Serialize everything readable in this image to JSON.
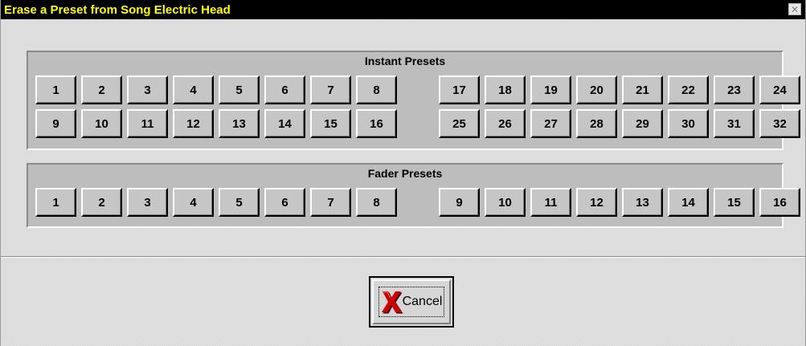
{
  "window": {
    "title": "Erase a Preset from Song Electric Head",
    "close_icon": "close-icon"
  },
  "colors": {
    "titlebar_bg": "#000000",
    "titlebar_text": "#ffff00",
    "x_icon": "#cc0000"
  },
  "instant_presets": {
    "title": "Instant Presets",
    "row1_left": [
      "1",
      "2",
      "3",
      "4",
      "5",
      "6",
      "7",
      "8"
    ],
    "row1_right": [
      "17",
      "18",
      "19",
      "20",
      "21",
      "22",
      "23",
      "24"
    ],
    "row2_left": [
      "9",
      "10",
      "11",
      "12",
      "13",
      "14",
      "15",
      "16"
    ],
    "row2_right": [
      "25",
      "26",
      "27",
      "28",
      "29",
      "30",
      "31",
      "32"
    ]
  },
  "fader_presets": {
    "title": "Fader Presets",
    "row1_left": [
      "1",
      "2",
      "3",
      "4",
      "5",
      "6",
      "7",
      "8"
    ],
    "row1_right": [
      "9",
      "10",
      "11",
      "12",
      "13",
      "14",
      "15",
      "16"
    ]
  },
  "cancel": {
    "label": "Cancel",
    "icon": "red-x-icon"
  }
}
